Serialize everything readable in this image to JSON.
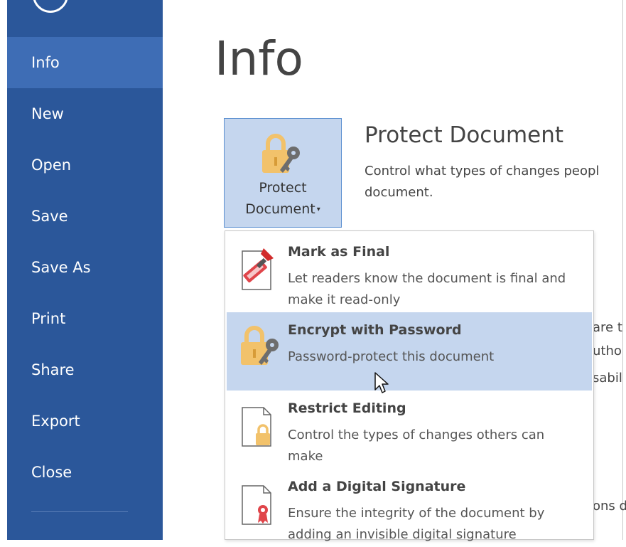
{
  "nav": {
    "items": [
      {
        "label": "Info",
        "active": true
      },
      {
        "label": "New"
      },
      {
        "label": "Open"
      },
      {
        "label": "Save"
      },
      {
        "label": "Save As"
      },
      {
        "label": "Print"
      },
      {
        "label": "Share"
      },
      {
        "label": "Export"
      },
      {
        "label": "Close"
      }
    ]
  },
  "main": {
    "title": "Info",
    "protect_button": {
      "line1": "Protect",
      "line2": "Document",
      "caret": "▾"
    },
    "protect_section": {
      "title": "Protect Document",
      "desc_line1": "Control what types of changes peopl",
      "desc_line2": "document."
    },
    "background_fragments": [
      "are t",
      "utho",
      "sabil",
      "ons d"
    ]
  },
  "menu": {
    "items": [
      {
        "title": "Mark as Final",
        "desc": "Let readers know the document is final and make it read-only",
        "icon": "mark-final-icon"
      },
      {
        "title": "Encrypt with Password",
        "desc": "Password-protect this document",
        "icon": "lock-key-icon",
        "hover": true
      },
      {
        "title": "Restrict Editing",
        "desc": "Control the types of changes others can make",
        "icon": "restrict-editing-icon"
      },
      {
        "title": "Add a Digital Signature",
        "desc": "Ensure the integrity of the document by adding an invisible digital signature",
        "icon": "digital-signature-icon"
      }
    ]
  },
  "colors": {
    "sidebar": "#2b579a",
    "sidebar_active": "#3e6db5",
    "highlight": "#c5d6ee",
    "lock_gold": "#f2c26b"
  }
}
